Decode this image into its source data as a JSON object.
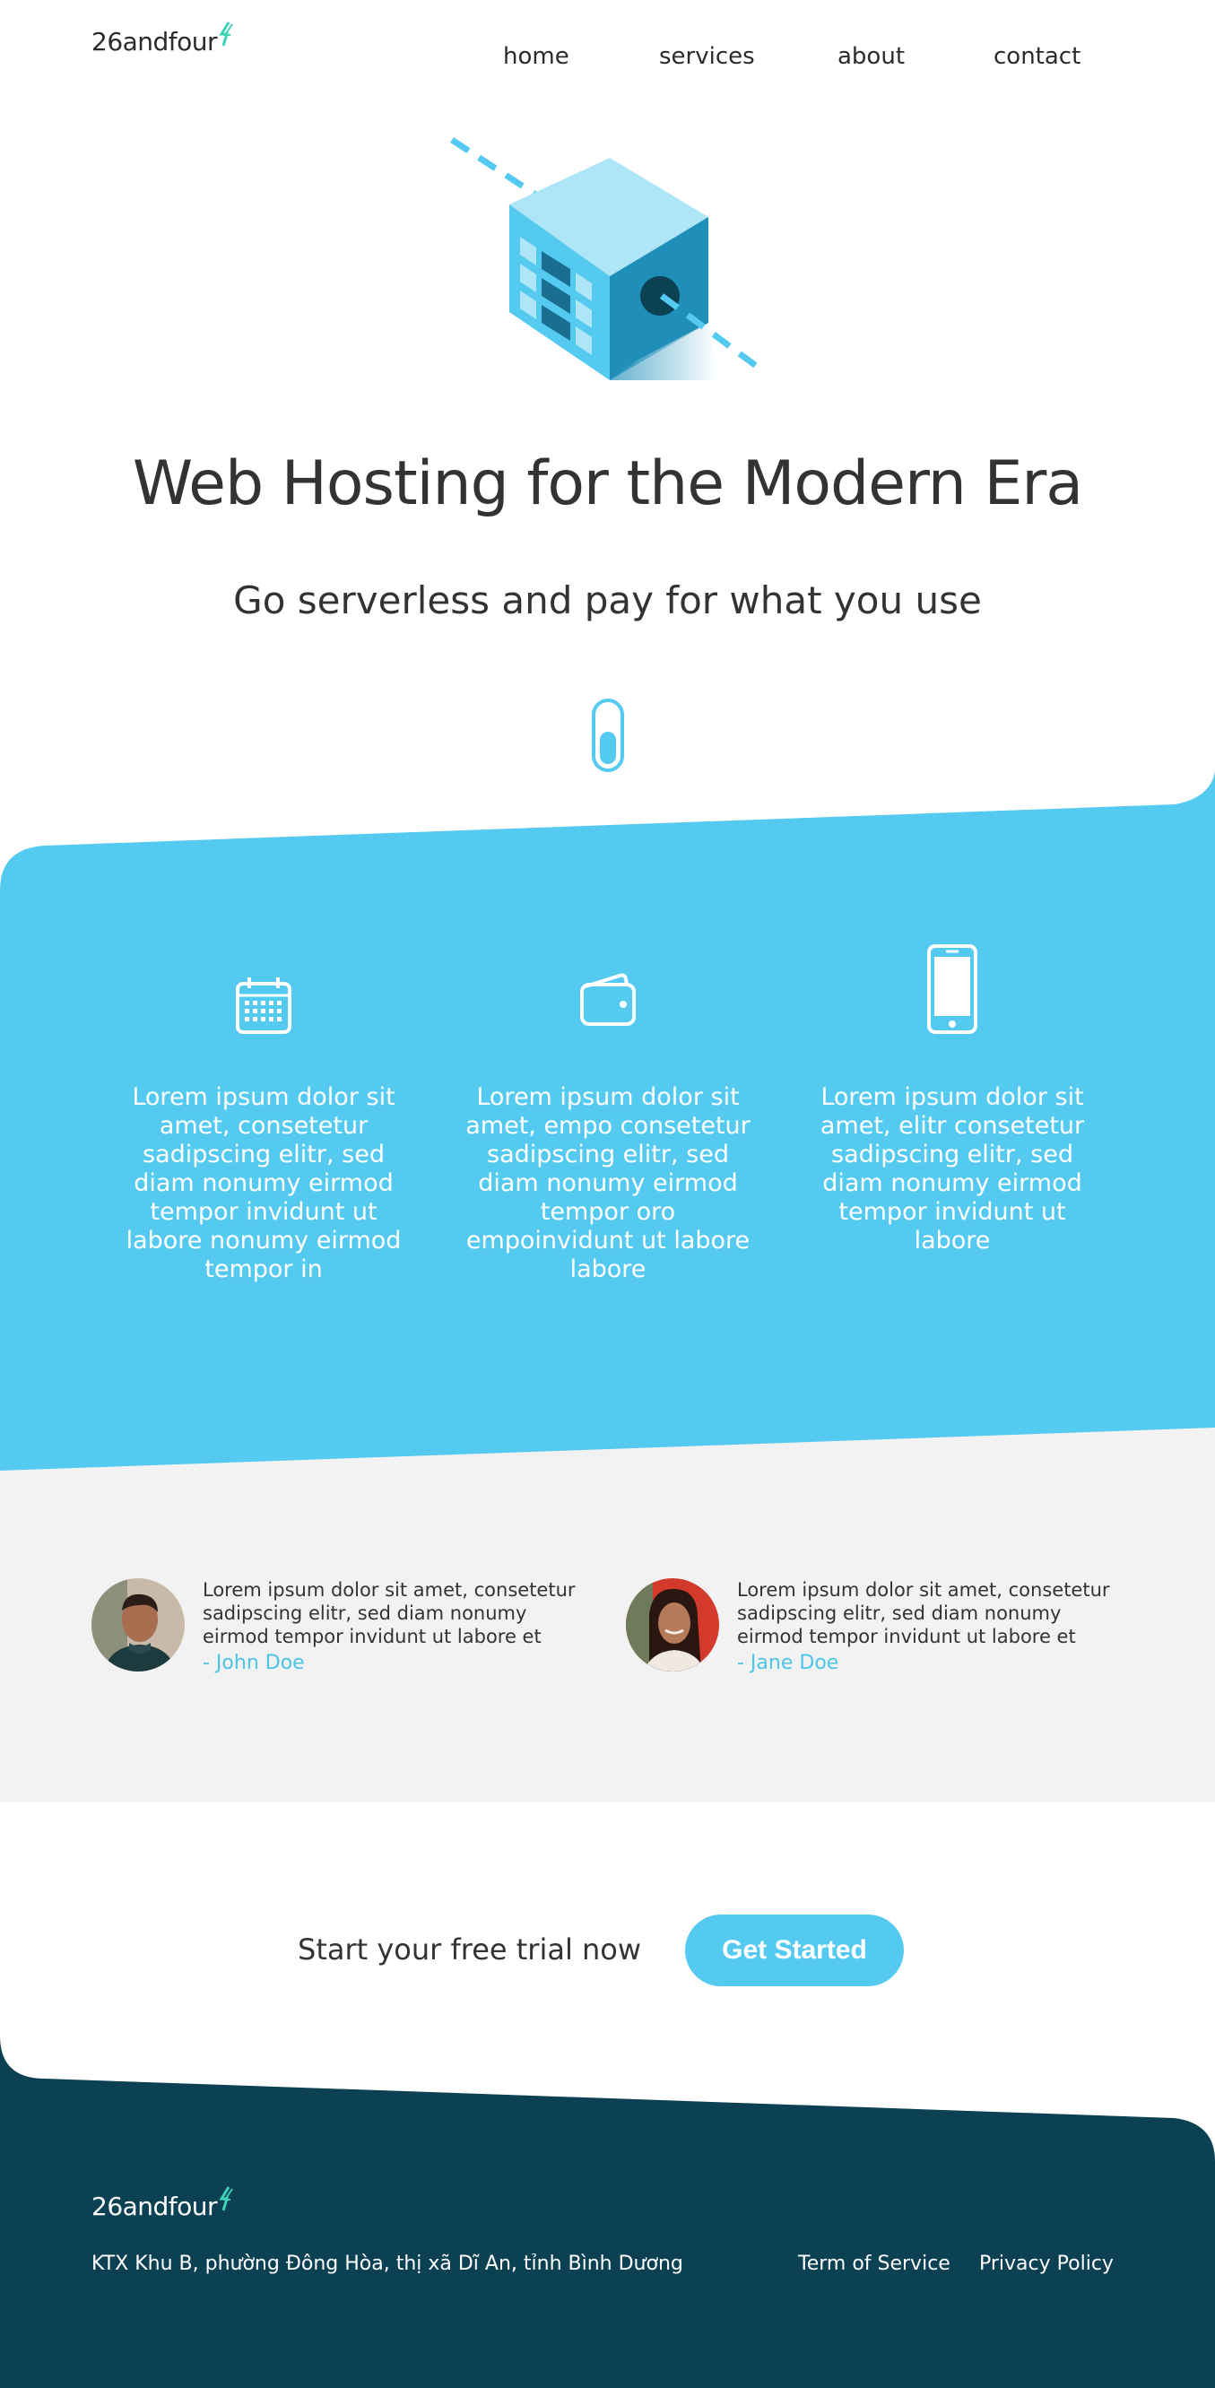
{
  "brand": {
    "name": "26andfour"
  },
  "nav": {
    "items": [
      "home",
      "services",
      "about",
      "contact"
    ]
  },
  "hero": {
    "title": "Web Hosting for the Modern Era",
    "subtitle": "Go serverless and pay for what you use"
  },
  "features": [
    {
      "icon": "calendar-icon",
      "text": "Lorem ipsum dolor sit amet, consetetur sadipscing elitr, sed diam nonumy eirmod tempor invidunt ut labore nonumy eirmod tempor in"
    },
    {
      "icon": "wallet-icon",
      "text": "Lorem ipsum dolor sit amet, empo consetetur sadipscing elitr, sed diam nonumy eirmod tempor oro empoinvidunt ut labore labore"
    },
    {
      "icon": "mobile-phone-icon",
      "text": "Lorem ipsum dolor sit amet, elitr consetetur sadipscing elitr, sed diam nonumy eirmod tempor invidunt ut labore"
    }
  ],
  "testimonials": [
    {
      "quote": "Lorem ipsum dolor sit amet, consetetur sadipscing elitr, sed diam nonumy eirmod tempor invidunt ut labore et",
      "author": "- John Doe"
    },
    {
      "quote": "Lorem ipsum dolor sit amet, consetetur sadipscing elitr, sed diam nonumy eirmod tempor invidunt ut labore et",
      "author": "- Jane Doe"
    }
  ],
  "cta": {
    "text": "Start your free trial now",
    "button": "Get Started"
  },
  "footer": {
    "address": "KTX Khu B, phường Đông Hòa, thị xã Dĩ An, tỉnh Bình Dương",
    "links": [
      "Term of Service",
      "Privacy Policy"
    ]
  },
  "colors": {
    "accent": "#55caf0",
    "light_gray": "#f2f2f2",
    "footer_navy": "#0c4153",
    "logo_bolt": "#3fd1b8"
  }
}
